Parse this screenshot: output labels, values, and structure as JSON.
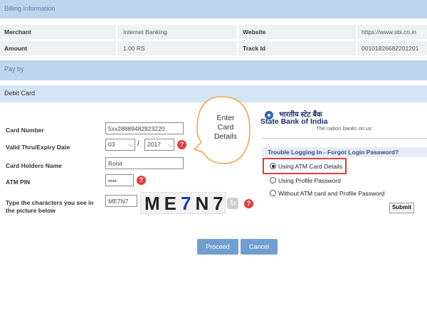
{
  "billing": {
    "title": "Billing Information",
    "rows": [
      {
        "key1": "Merchant",
        "val1": "Internet Banking",
        "key2": "Website",
        "val2": "https://www.sbi.co.in"
      },
      {
        "key1": "Amount",
        "val1": "1.00 RS",
        "key2": "Track Id",
        "val2": "00101826682201201"
      }
    ]
  },
  "payby": {
    "title": "Pay by"
  },
  "debit": {
    "title": "Debit Card",
    "card_number_label": "Card Number",
    "card_number_value": "5xx28889482923220",
    "expiry_label": "Valid Thru/Expiry Date",
    "expiry_month": "03",
    "expiry_separator": "/",
    "expiry_year": "2017",
    "holder_label": "Card Holders Name",
    "holder_value": "Rohit",
    "pin_label": "ATM PIN",
    "pin_value": "••••",
    "captcha_label": "Type the characters you see in the picture below",
    "captcha_input": "ME7N7",
    "captcha_chars": [
      "M",
      "E",
      "7",
      "N",
      "7"
    ],
    "help_icon_glyph": "?",
    "refresh_glyph": "↻"
  },
  "callout": {
    "text": [
      "Enter",
      "Card",
      "Details"
    ]
  },
  "buttons": {
    "proceed": "Proceed",
    "cancel": "Cancel"
  },
  "sbi": {
    "hindi_name": "भारतीय स्टेट बैंक",
    "name": "State Bank of India",
    "tagline": "The nation banks on us",
    "trouble": "Trouble Logging In - Forgot Login Password?",
    "options": [
      "Using ATM Card Details",
      "Using Profile Password",
      "Without ATM card and Profile Password"
    ],
    "selected_option": "Using ATM Card Details",
    "submit": "Submit"
  },
  "colors": {
    "bar": "#bcd6ee",
    "button": "#6f9fd0",
    "highlight": "#e23a3a",
    "help": "#e63b3b",
    "callout_border": "#f0a040"
  }
}
